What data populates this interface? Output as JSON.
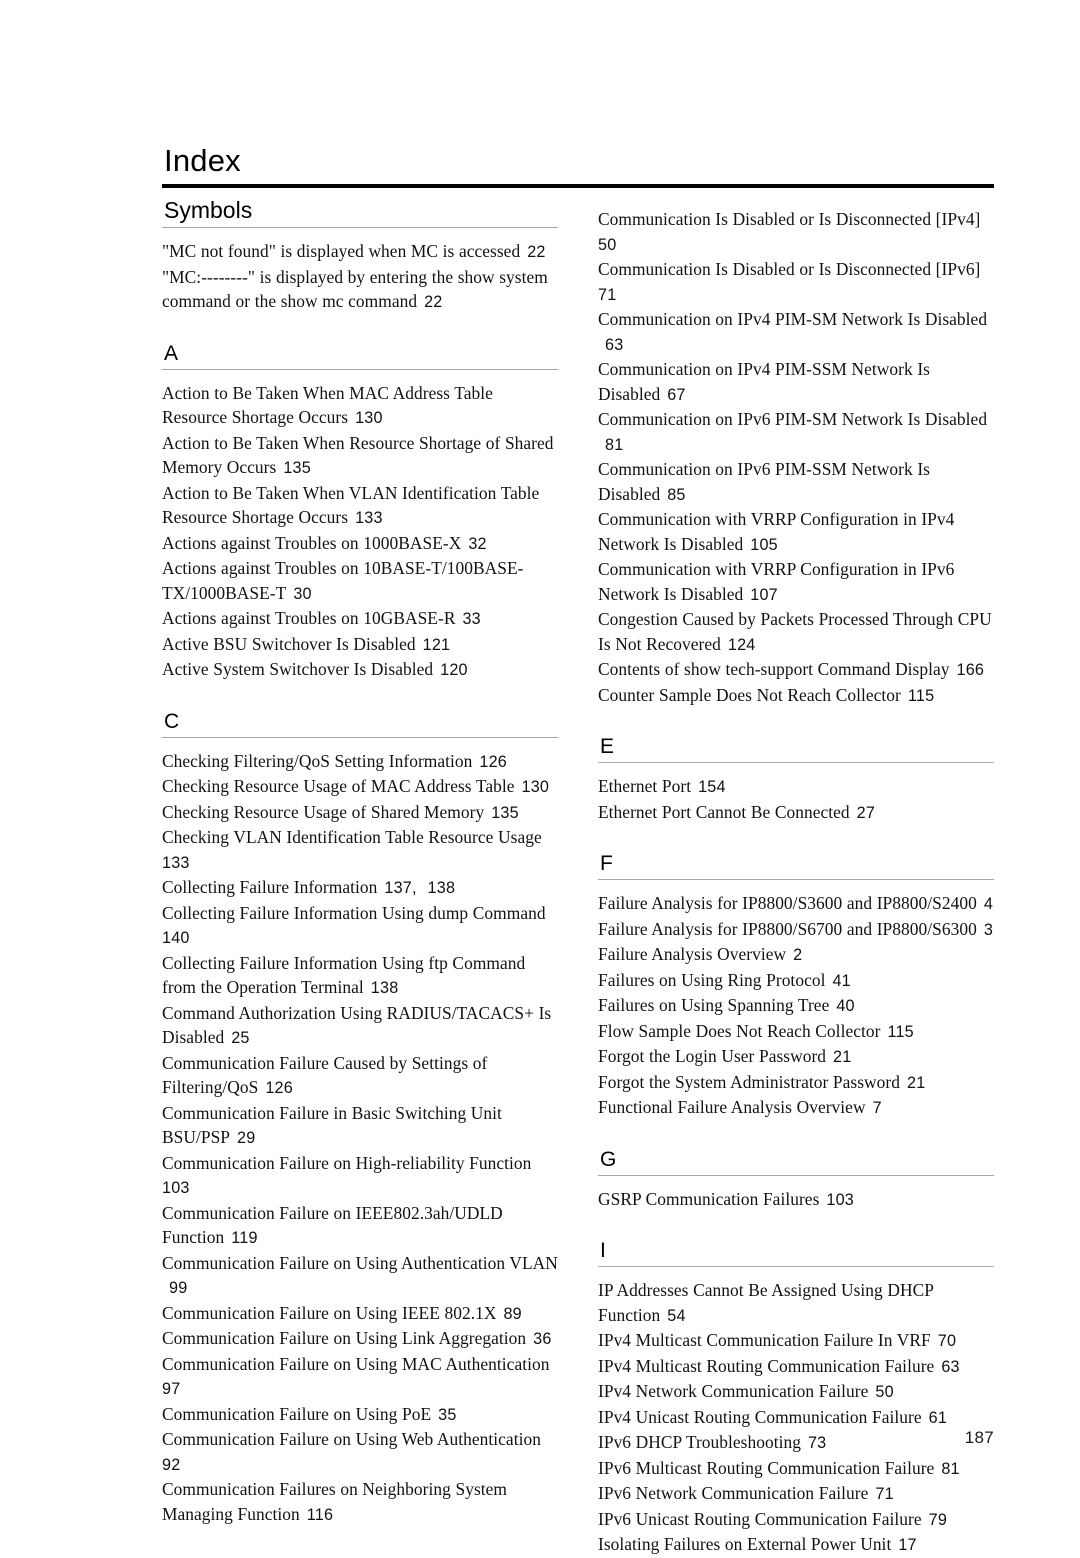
{
  "page": {
    "title": "Index",
    "folio": "187"
  },
  "columns": {
    "left": [
      {
        "heading": "Symbols",
        "heading_style": "word",
        "entries": [
          {
            "text": "\"MC not found\" is displayed when MC is accessed",
            "pages": [
              "22"
            ]
          },
          {
            "text": "\"MC:--------\" is displayed by entering the show system command or the show mc command",
            "pages": [
              "22"
            ]
          }
        ]
      },
      {
        "heading": "A",
        "heading_style": "letter",
        "entries": [
          {
            "text": "Action to Be Taken When MAC Address Table Resource Shortage Occurs",
            "pages": [
              "130"
            ]
          },
          {
            "text": "Action to Be Taken When Resource Shortage of Shared Memory Occurs",
            "pages": [
              "135"
            ]
          },
          {
            "text": "Action to Be Taken When VLAN Identification Table Resource Shortage Occurs",
            "pages": [
              "133"
            ]
          },
          {
            "text": "Actions against Troubles on 1000BASE-X",
            "pages": [
              "32"
            ]
          },
          {
            "text": "Actions against Troubles on 10BASE-T/100BASE-TX/1000BASE-T",
            "pages": [
              "30"
            ]
          },
          {
            "text": "Actions against Troubles on 10GBASE-R",
            "pages": [
              "33"
            ]
          },
          {
            "text": "Active BSU Switchover Is Disabled",
            "pages": [
              "121"
            ]
          },
          {
            "text": "Active System Switchover Is Disabled",
            "pages": [
              "120"
            ]
          }
        ]
      },
      {
        "heading": "C",
        "heading_style": "letter",
        "entries": [
          {
            "text": "Checking Filtering/QoS Setting Information",
            "pages": [
              "126"
            ]
          },
          {
            "text": "Checking Resource Usage of MAC Address Table",
            "pages": [
              "130"
            ]
          },
          {
            "text": "Checking Resource Usage of Shared Memory",
            "pages": [
              "135"
            ]
          },
          {
            "text": "Checking VLAN Identification Table Resource Usage",
            "pages": [
              "133"
            ]
          },
          {
            "text": "Collecting Failure Information",
            "pages": [
              "137",
              "138"
            ]
          },
          {
            "text": "Collecting Failure Information Using dump Command",
            "pages": [
              "140"
            ]
          },
          {
            "text": "Collecting Failure Information Using ftp Command from the Operation Terminal",
            "pages": [
              "138"
            ]
          },
          {
            "text": "Command Authorization Using RADIUS/TACACS+ Is Disabled",
            "pages": [
              "25"
            ]
          },
          {
            "text": "Communication Failure Caused by Settings of Filtering/QoS",
            "pages": [
              "126"
            ]
          },
          {
            "text": "Communication Failure in Basic Switching Unit BSU/PSP",
            "pages": [
              "29"
            ]
          },
          {
            "text": "Communication Failure on High-reliability Function",
            "pages": [
              "103"
            ]
          },
          {
            "text": "Communication Failure on IEEE802.3ah/UDLD Function",
            "pages": [
              "119"
            ]
          },
          {
            "text": "Communication Failure on Using Authentication VLAN",
            "pages": [
              "99"
            ]
          },
          {
            "text": "Communication Failure on Using IEEE 802.1X",
            "pages": [
              "89"
            ]
          },
          {
            "text": "Communication Failure on Using Link Aggregation",
            "pages": [
              "36"
            ]
          },
          {
            "text": "Communication Failure on Using MAC Authentication",
            "pages": [
              "97"
            ]
          },
          {
            "text": "Communication Failure on Using PoE",
            "pages": [
              "35"
            ]
          },
          {
            "text": "Communication Failure on Using Web Authentication",
            "pages": [
              "92"
            ]
          },
          {
            "text": "Communication Failures on Neighboring System Managing Function",
            "pages": [
              "116"
            ]
          }
        ]
      }
    ],
    "right": [
      {
        "heading": "",
        "heading_style": "none",
        "entries": [
          {
            "text": "Communication Is Disabled or Is Disconnected [IPv4]",
            "pages": [
              "50"
            ]
          },
          {
            "text": "Communication Is Disabled or Is Disconnected [IPv6]",
            "pages": [
              "71"
            ]
          },
          {
            "text": "Communication on IPv4 PIM-SM Network Is Disabled",
            "pages": [
              "63"
            ]
          },
          {
            "text": "Communication on IPv4 PIM-SSM Network Is Disabled",
            "pages": [
              "67"
            ]
          },
          {
            "text": "Communication on IPv6 PIM-SM Network Is Disabled",
            "pages": [
              "81"
            ]
          },
          {
            "text": "Communication on IPv6 PIM-SSM Network Is Disabled",
            "pages": [
              "85"
            ]
          },
          {
            "text": "Communication with VRRP Configuration in IPv4 Network Is Disabled",
            "pages": [
              "105"
            ]
          },
          {
            "text": "Communication with VRRP Configuration in IPv6 Network Is Disabled",
            "pages": [
              "107"
            ]
          },
          {
            "text": "Congestion Caused by Packets Processed Through CPU Is Not Recovered",
            "pages": [
              "124"
            ]
          },
          {
            "text": "Contents of show tech-support Command Display",
            "pages": [
              "166"
            ]
          },
          {
            "text": "Counter Sample Does Not Reach Collector",
            "pages": [
              "115"
            ]
          }
        ]
      },
      {
        "heading": "E",
        "heading_style": "letter",
        "entries": [
          {
            "text": "Ethernet Port",
            "pages": [
              "154"
            ]
          },
          {
            "text": "Ethernet Port Cannot Be Connected",
            "pages": [
              "27"
            ]
          }
        ]
      },
      {
        "heading": "F",
        "heading_style": "letter",
        "entries": [
          {
            "text": "Failure Analysis for IP8800/S3600 and IP8800/S2400",
            "pages": [
              "4"
            ]
          },
          {
            "text": "Failure Analysis for IP8800/S6700 and IP8800/S6300",
            "pages": [
              "3"
            ]
          },
          {
            "text": "Failure Analysis Overview",
            "pages": [
              "2"
            ]
          },
          {
            "text": "Failures on Using Ring Protocol",
            "pages": [
              "41"
            ]
          },
          {
            "text": "Failures on Using Spanning Tree",
            "pages": [
              "40"
            ]
          },
          {
            "text": "Flow Sample Does Not Reach Collector",
            "pages": [
              "115"
            ]
          },
          {
            "text": "Forgot the Login User Password",
            "pages": [
              "21"
            ]
          },
          {
            "text": "Forgot the System Administrator Password",
            "pages": [
              "21"
            ]
          },
          {
            "text": "Functional Failure Analysis Overview",
            "pages": [
              "7"
            ]
          }
        ]
      },
      {
        "heading": "G",
        "heading_style": "letter",
        "entries": [
          {
            "text": "GSRP Communication Failures",
            "pages": [
              "103"
            ]
          }
        ]
      },
      {
        "heading": "I",
        "heading_style": "letter",
        "entries": [
          {
            "text": "IP Addresses Cannot Be Assigned Using DHCP Function",
            "pages": [
              "54"
            ]
          },
          {
            "text": "IPv4 Multicast Communication Failure In VRF",
            "pages": [
              "70"
            ]
          },
          {
            "text": "IPv4 Multicast Routing Communication Failure",
            "pages": [
              "63"
            ]
          },
          {
            "text": "IPv4 Network Communication Failure",
            "pages": [
              "50"
            ]
          },
          {
            "text": "IPv4 Unicast Routing Communication Failure",
            "pages": [
              "61"
            ]
          },
          {
            "text": "IPv6 DHCP Troubleshooting",
            "pages": [
              "73"
            ]
          },
          {
            "text": "IPv6 Multicast Routing Communication Failure",
            "pages": [
              "81"
            ]
          },
          {
            "text": "IPv6 Network Communication Failure",
            "pages": [
              "71"
            ]
          },
          {
            "text": "IPv6 Unicast Routing Communication Failure",
            "pages": [
              "79"
            ]
          },
          {
            "text": "Isolating Failures on External Power Unit",
            "pages": [
              "17"
            ]
          }
        ]
      }
    ]
  }
}
